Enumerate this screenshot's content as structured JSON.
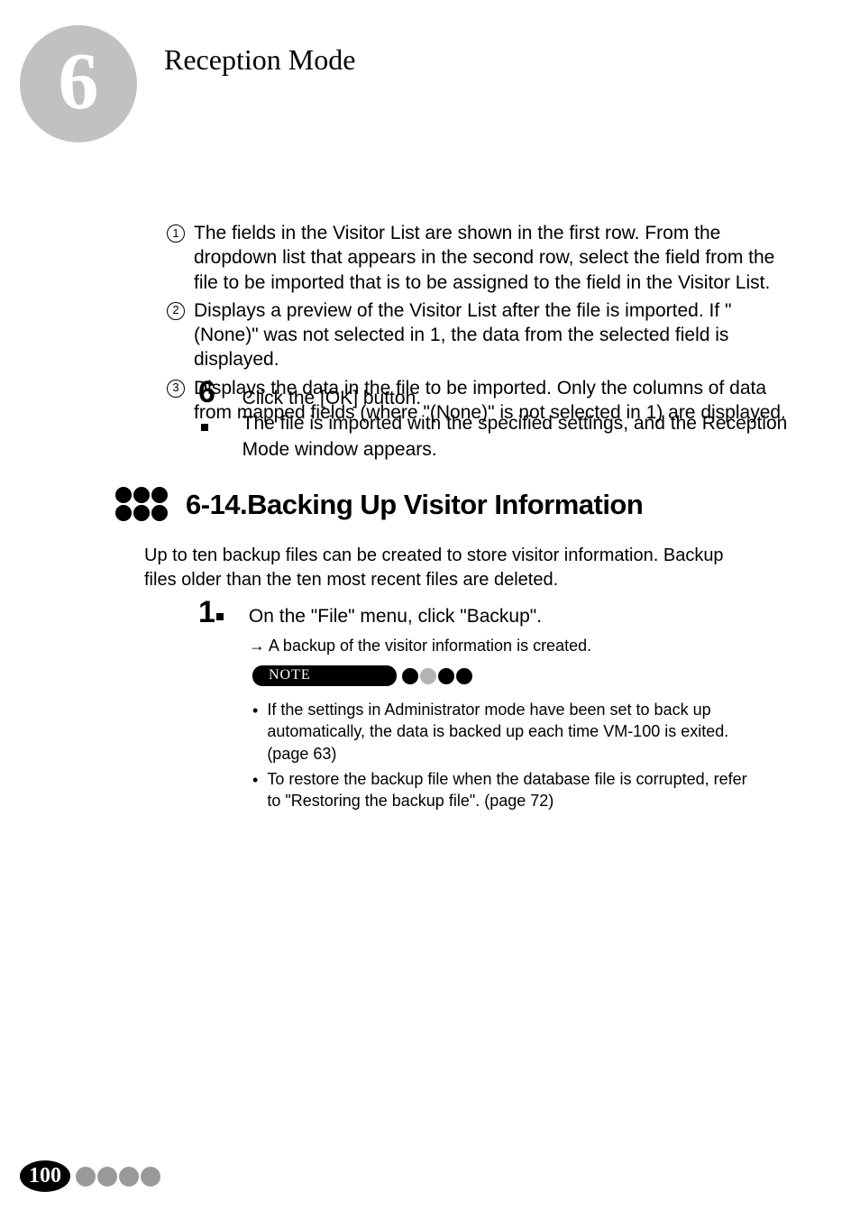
{
  "chapter": {
    "number": "6",
    "title": "Reception Mode"
  },
  "enumerated": {
    "n1": "The fields in the Visitor List are shown in the first row. From the dropdown list that appears in the second row, select the field from the file to be imported that is to be assigned to the field in the Visitor List.",
    "n2": "Displays a preview of the Visitor List after the file is imported. If \"(None)\" was not selected in 1, the data from the selected field is displayed.",
    "n3": "Displays the data in the file to be imported. Only the columns of data from mapped fields (where \"(None)\" is not selected in 1) are displayed."
  },
  "step6": {
    "num": "6",
    "line1": "Click the [OK] button.",
    "line2": "The file is imported with the specified settings, and the Reception Mode window appears."
  },
  "section": {
    "heading": "6-14.Backing Up Visitor Information",
    "para": "Up to ten backup files can be created to store visitor information. Backup files older than the ten most recent files are deleted."
  },
  "step1": {
    "num": "1",
    "line1": "On the \"File\" menu, click \"Backup\".",
    "arrow_line": "A backup of the visitor information is created."
  },
  "note": {
    "label": "NOTE",
    "b1": "If the settings in Administrator mode have been set to back up automatically, the data is backed up each time VM-100 is exited. (page 63)",
    "b2": "To restore the backup file when the database file is corrupted, refer to \"Restoring the backup file\". (page 72)"
  },
  "footer": {
    "page": "100"
  }
}
